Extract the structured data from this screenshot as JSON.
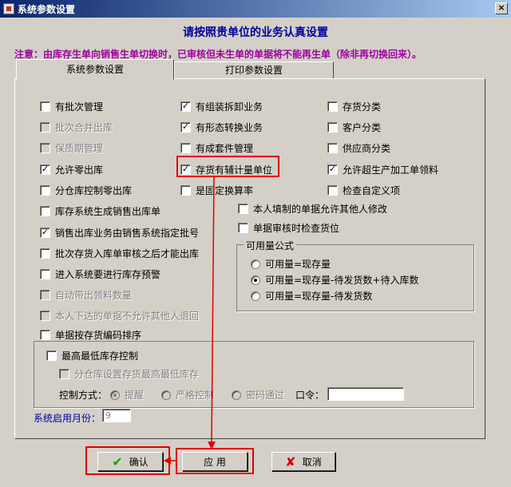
{
  "window": {
    "title": "系统参数设置",
    "close_glyph": "×"
  },
  "heading": "请按照贵单位的业务认真设置",
  "notice": "注意：由库存生单向销售生单切换时，已审核但未生单的单据将不能再生单（除非再切换回来）。",
  "tabs": [
    {
      "label": "系统参数设置"
    },
    {
      "label": "打印参数设置"
    }
  ],
  "options": {
    "col1": [
      {
        "label": "有批次管理",
        "checked": false,
        "disabled": false
      },
      {
        "label": "批次合并出库",
        "checked": false,
        "disabled": true
      },
      {
        "label": "保质期管理",
        "checked": false,
        "disabled": true
      },
      {
        "label": "允许零出库",
        "checked": true,
        "disabled": false
      },
      {
        "label": "分仓库控制零出库",
        "checked": false,
        "disabled": false
      },
      {
        "label": "库存系统生成销售出库单",
        "checked": false,
        "disabled": false
      },
      {
        "label": "销售出库业务由销售系统指定批号",
        "checked": true,
        "disabled": false
      },
      {
        "label": "批次存货入库单审核之后才能出库",
        "checked": false,
        "disabled": false
      },
      {
        "label": "进入系统要进行库存预警",
        "checked": false,
        "disabled": false
      },
      {
        "label": "自动带出领料数量",
        "checked": false,
        "disabled": true
      },
      {
        "label": "本人下达的单据不允许其他人退回",
        "checked": false,
        "disabled": true
      },
      {
        "label": "单据按存货编码排序",
        "checked": false,
        "disabled": false
      }
    ],
    "col2": [
      {
        "label": "有组装拆卸业务",
        "checked": true
      },
      {
        "label": "有形态转换业务",
        "checked": true
      },
      {
        "label": "有成套件管理",
        "checked": false
      },
      {
        "label": "存货有辅计量单位",
        "checked": true
      },
      {
        "label": "是固定换算率",
        "checked": false
      }
    ],
    "col3": [
      {
        "label": "存货分类",
        "checked": false
      },
      {
        "label": "客户分类",
        "checked": false
      },
      {
        "label": "供应商分类",
        "checked": false
      },
      {
        "label": "允许超生产加工单领料",
        "checked": true
      },
      {
        "label": "检查自定义项",
        "checked": false
      }
    ],
    "mid": [
      {
        "label": "本人填制的单据允许其他人修改",
        "checked": false
      },
      {
        "label": "单据审核时检查货位",
        "checked": false
      }
    ]
  },
  "available_formula": {
    "title": "可用量公式",
    "choices": [
      {
        "label": "可用量=现存量",
        "selected": false
      },
      {
        "label": "可用量=现存量-待发货数+待入库数",
        "selected": true
      },
      {
        "label": "可用量=现存量-待发货数",
        "selected": false
      }
    ]
  },
  "stock_limit": {
    "label": "最高最低库存控制",
    "checked": false,
    "sub_label": "分仓库设置存货最高最低库存",
    "sub_checked": false,
    "method_label": "控制方式：",
    "methods": [
      {
        "label": "提醒",
        "selected": true
      },
      {
        "label": "严格控制",
        "selected": false
      },
      {
        "label": "密码通过",
        "selected": false
      }
    ],
    "password_label": "口令：",
    "password_value": ""
  },
  "start_month": {
    "label": "系统启用月份：",
    "value": "9"
  },
  "buttons": {
    "confirm": "确认",
    "apply": "应 用",
    "cancel": "取消"
  },
  "colors": {
    "title_start": "#0a246a",
    "notice": "#a000a0",
    "heading": "#0000a0",
    "highlight": "#e00000"
  }
}
